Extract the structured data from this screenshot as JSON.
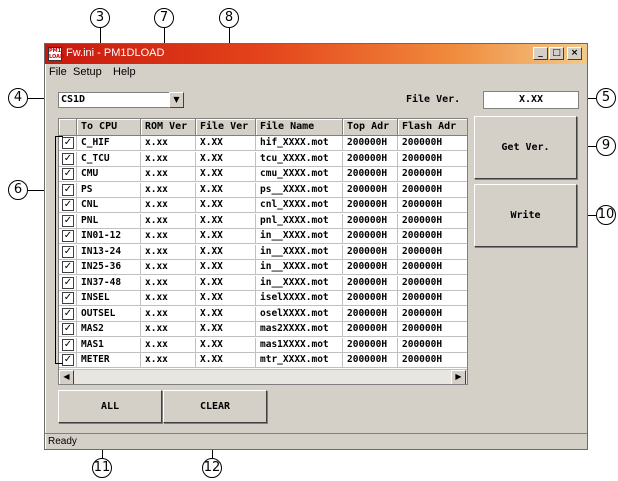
{
  "window": {
    "title": "Fw.ini - PM1DLOAD",
    "logo_text": "PM1 LOAD",
    "minimize": "_",
    "maximize": "□",
    "close": "×"
  },
  "menu": [
    "File",
    "Setup",
    "Help"
  ],
  "combo": {
    "value": "CS1D"
  },
  "file_ver": {
    "label": "File Ver.",
    "value": "X.XX"
  },
  "columns": [
    "To CPU",
    "ROM Ver",
    "File Ver",
    "File Name",
    "Top Adr",
    "Flash Adr"
  ],
  "rows": [
    {
      "checked": "✓",
      "cpu": "C_HIF",
      "rom": "x.xx",
      "file": "X.XX",
      "name": "hif_XXXX.mot",
      "top": "200000H",
      "flash": "200000H"
    },
    {
      "checked": "✓",
      "cpu": "C_TCU",
      "rom": "x.xx",
      "file": "X.XX",
      "name": "tcu_XXXX.mot",
      "top": "200000H",
      "flash": "200000H"
    },
    {
      "checked": "✓",
      "cpu": "CMU",
      "rom": "x.xx",
      "file": "X.XX",
      "name": "cmu_XXXX.mot",
      "top": "200000H",
      "flash": "200000H"
    },
    {
      "checked": "✓",
      "cpu": "PS",
      "rom": "x.xx",
      "file": "X.XX",
      "name": "ps__XXXX.mot",
      "top": "200000H",
      "flash": "200000H"
    },
    {
      "checked": "✓",
      "cpu": "CNL",
      "rom": "x.xx",
      "file": "X.XX",
      "name": "cnl_XXXX.mot",
      "top": "200000H",
      "flash": "200000H"
    },
    {
      "checked": "✓",
      "cpu": "PNL",
      "rom": "x.xx",
      "file": "X.XX",
      "name": "pnl_XXXX.mot",
      "top": "200000H",
      "flash": "200000H"
    },
    {
      "checked": "✓",
      "cpu": "IN01-12",
      "rom": "x.xx",
      "file": "X.XX",
      "name": "in__XXXX.mot",
      "top": "200000H",
      "flash": "200000H"
    },
    {
      "checked": "✓",
      "cpu": "IN13-24",
      "rom": "x.xx",
      "file": "X.XX",
      "name": "in__XXXX.mot",
      "top": "200000H",
      "flash": "200000H"
    },
    {
      "checked": "✓",
      "cpu": "IN25-36",
      "rom": "x.xx",
      "file": "X.XX",
      "name": "in__XXXX.mot",
      "top": "200000H",
      "flash": "200000H"
    },
    {
      "checked": "✓",
      "cpu": "IN37-48",
      "rom": "x.xx",
      "file": "X.XX",
      "name": "in__XXXX.mot",
      "top": "200000H",
      "flash": "200000H"
    },
    {
      "checked": "✓",
      "cpu": "INSEL",
      "rom": "x.xx",
      "file": "X.XX",
      "name": "iselXXXX.mot",
      "top": "200000H",
      "flash": "200000H"
    },
    {
      "checked": "✓",
      "cpu": "OUTSEL",
      "rom": "x.xx",
      "file": "X.XX",
      "name": "oselXXXX.mot",
      "top": "200000H",
      "flash": "200000H"
    },
    {
      "checked": "✓",
      "cpu": "MAS2",
      "rom": "x.xx",
      "file": "X.XX",
      "name": "mas2XXXX.mot",
      "top": "200000H",
      "flash": "200000H"
    },
    {
      "checked": "✓",
      "cpu": "MAS1",
      "rom": "x.xx",
      "file": "X.XX",
      "name": "mas1XXXX.mot",
      "top": "200000H",
      "flash": "200000H"
    },
    {
      "checked": "✓",
      "cpu": "METER",
      "rom": "x.xx",
      "file": "X.XX",
      "name": "mtr_XXXX.mot",
      "top": "200000H",
      "flash": "200000H"
    }
  ],
  "scroll": {
    "left": "◀",
    "right": "▶",
    "dropdown": "▼"
  },
  "buttons": {
    "get_ver": "Get Ver.",
    "write": "Write",
    "all": "ALL",
    "clear": "CLEAR"
  },
  "status": "Ready",
  "callouts": [
    "3",
    "7",
    "8",
    "4",
    "5",
    "6",
    "9",
    "10",
    "11",
    "12"
  ]
}
